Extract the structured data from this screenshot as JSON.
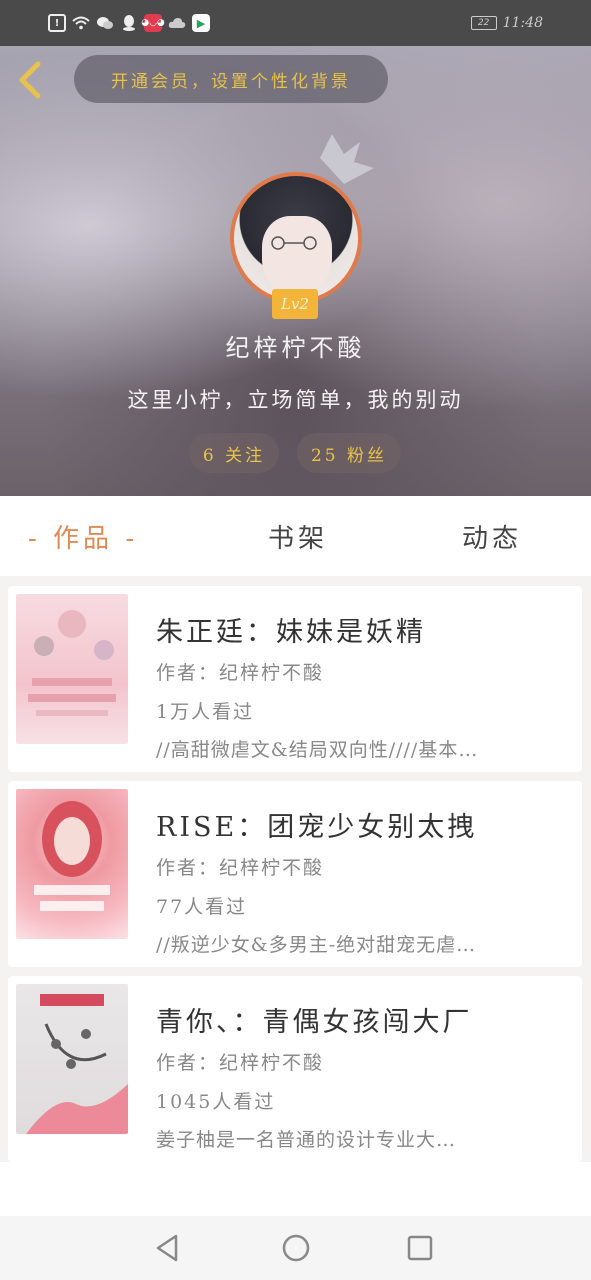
{
  "status_bar": {
    "icons": [
      "alert-icon",
      "wifi-icon",
      "wechat-icon",
      "qq-icon",
      "app-icon",
      "cloud-icon",
      "play-store-icon"
    ],
    "battery": "22",
    "time": "11:48"
  },
  "header": {
    "vip_banner": "开通会员，设置个性化背景",
    "level": "Lv2",
    "username": "纪梓柠不酸",
    "bio": "这里小柠，立场简单，我的别动",
    "following": "6 关注",
    "fans": "25 粉丝"
  },
  "tabs": [
    {
      "label": "- 作品 -",
      "active": true
    },
    {
      "label": "书架",
      "active": false
    },
    {
      "label": "动态",
      "active": false
    }
  ],
  "books": [
    {
      "title": "朱正廷：妹妹是妖精",
      "author": "作者：纪梓柠不酸",
      "views": "1万人看过",
      "desc": "//高甜微虐文&结局双向性////基本…"
    },
    {
      "title": "RISE：团宠少女别太拽",
      "author": "作者：纪梓柠不酸",
      "views": "77人看过",
      "desc": "//叛逆少女&多男主-绝对甜宠无虐…"
    },
    {
      "title": "青你、：青偶女孩闯大厂",
      "author": "作者：纪梓柠不酸",
      "views": "1045人看过",
      "desc": "姜子柚是一名普通的设计专业大…"
    }
  ],
  "colors": {
    "accent_orange": "#e08a55",
    "gold": "#e9c24a",
    "badge": "#f3b43a"
  }
}
